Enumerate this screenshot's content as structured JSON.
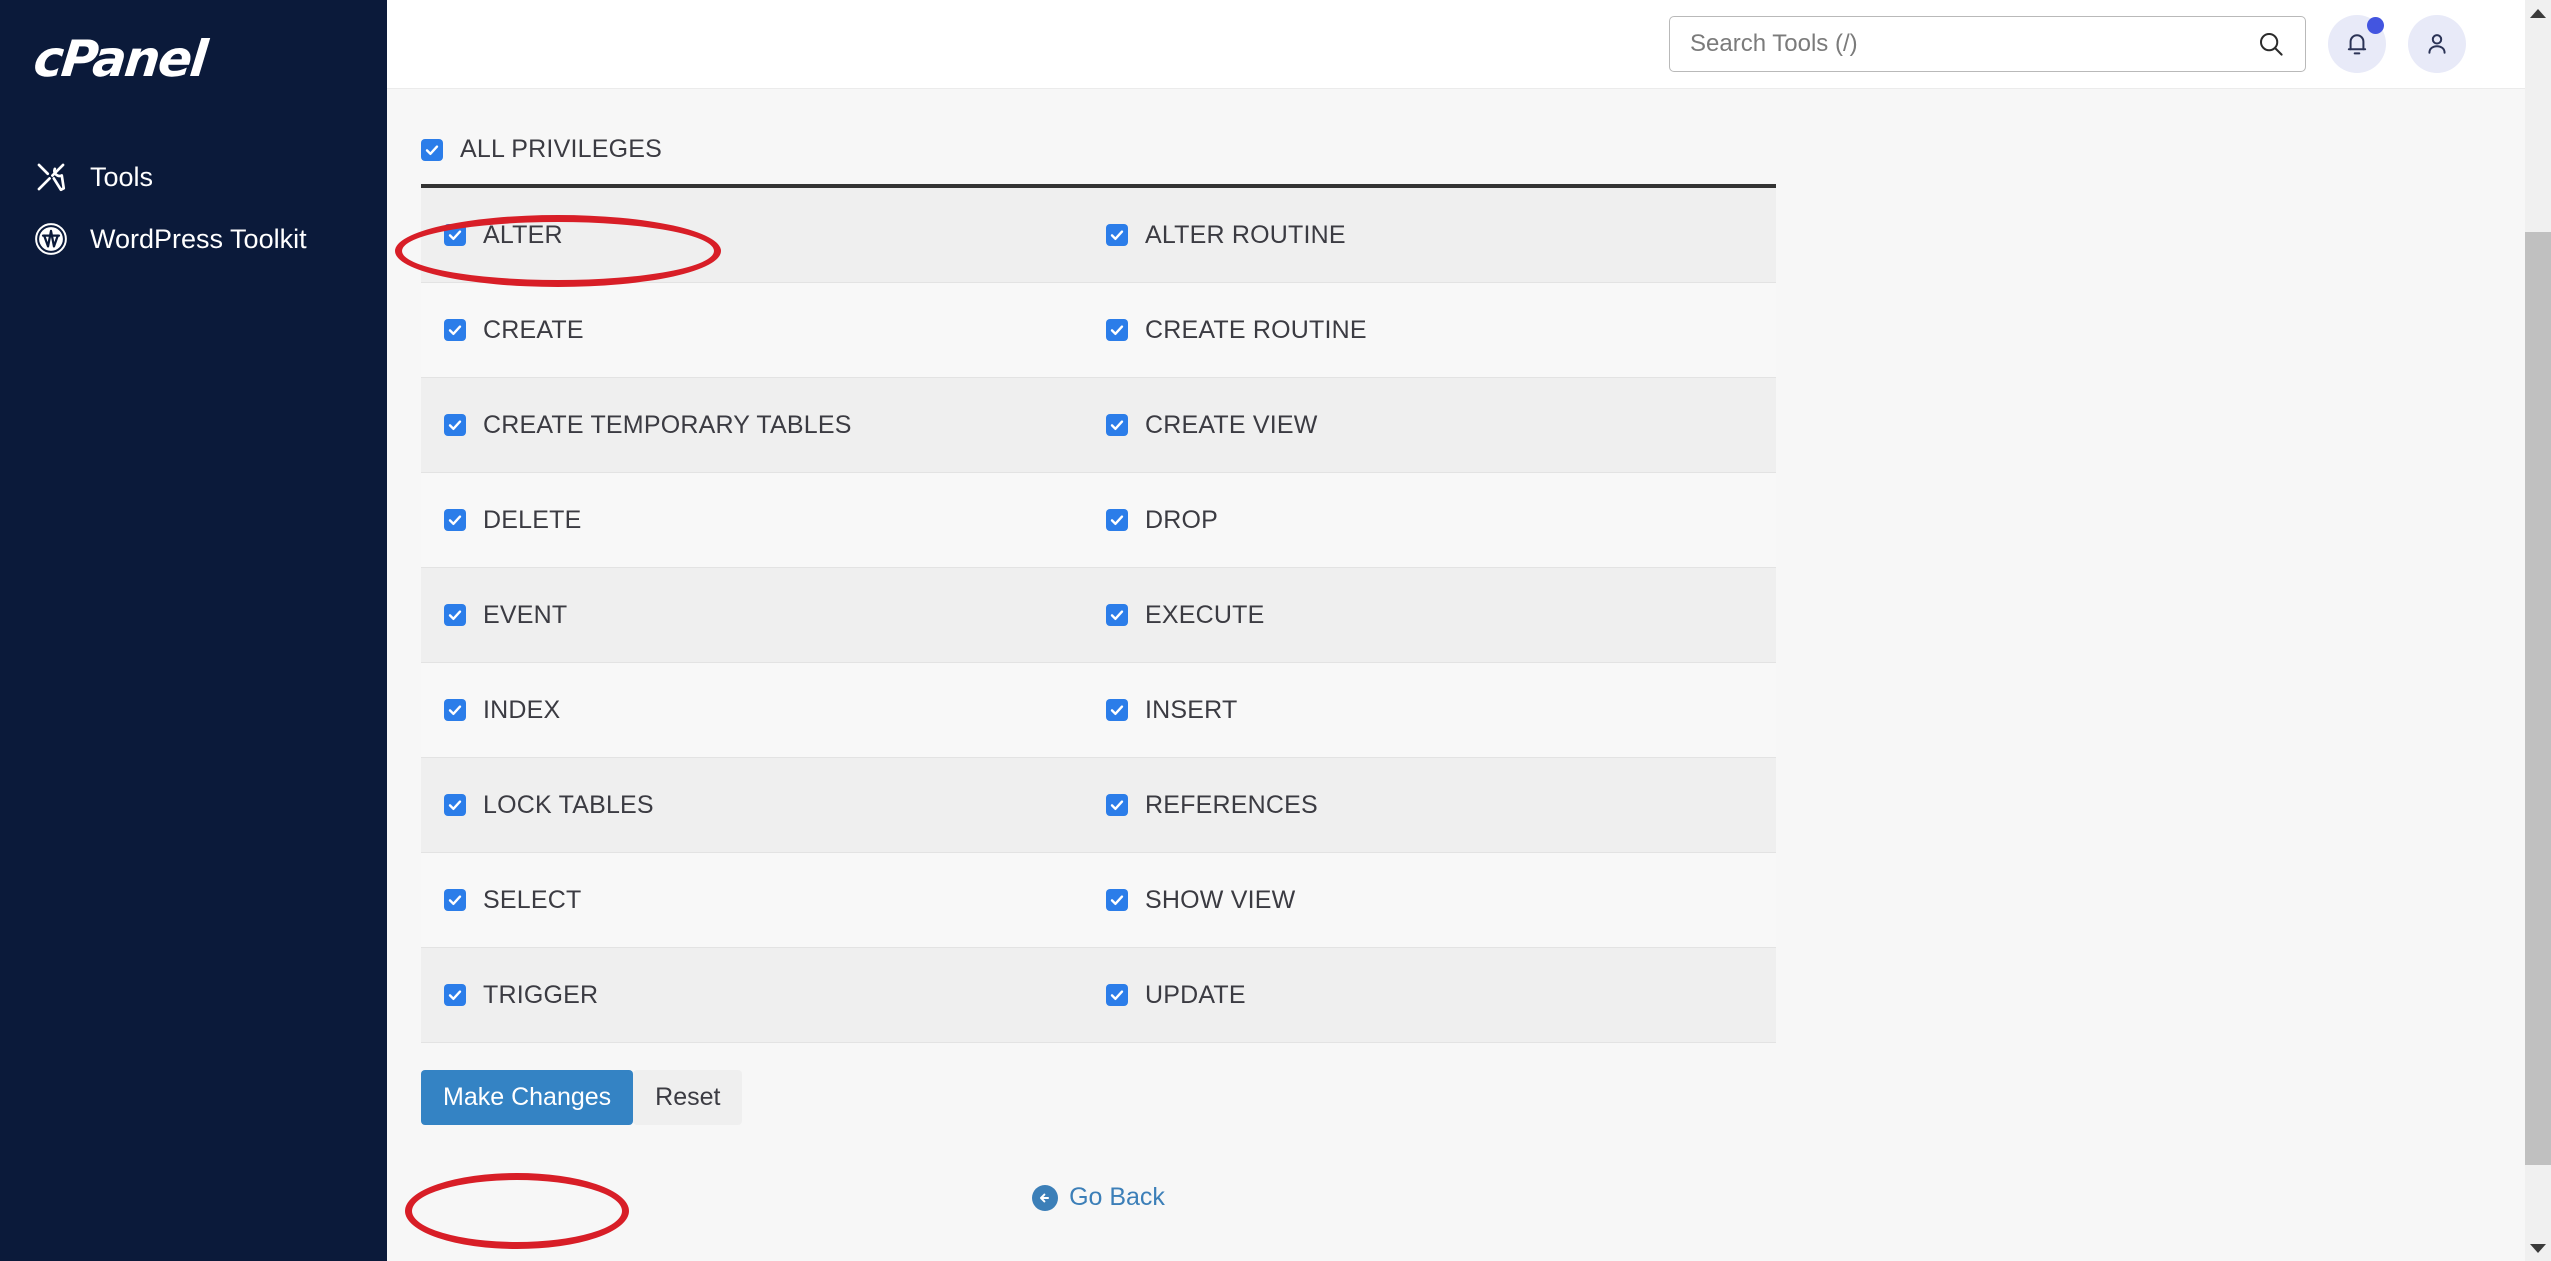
{
  "sidebar": {
    "brand": "cPanel",
    "items": [
      {
        "label": "Tools",
        "icon": "tools-icon"
      },
      {
        "label": "WordPress Toolkit",
        "icon": "wordpress-icon"
      }
    ]
  },
  "topbar": {
    "search": {
      "placeholder": "Search Tools (/)",
      "value": "",
      "icon": "search-icon"
    },
    "notifications": {
      "icon": "bell-icon",
      "has_badge": true
    },
    "account": {
      "icon": "user-icon"
    }
  },
  "main": {
    "all_privileges": {
      "label": "ALL PRIVILEGES",
      "checked": true
    },
    "privileges": [
      {
        "left": "ALTER",
        "right": "ALTER ROUTINE",
        "left_checked": true,
        "right_checked": true
      },
      {
        "left": "CREATE",
        "right": "CREATE ROUTINE",
        "left_checked": true,
        "right_checked": true
      },
      {
        "left": "CREATE TEMPORARY TABLES",
        "right": "CREATE VIEW",
        "left_checked": true,
        "right_checked": true
      },
      {
        "left": "DELETE",
        "right": "DROP",
        "left_checked": true,
        "right_checked": true
      },
      {
        "left": "EVENT",
        "right": "EXECUTE",
        "left_checked": true,
        "right_checked": true
      },
      {
        "left": "INDEX",
        "right": "INSERT",
        "left_checked": true,
        "right_checked": true
      },
      {
        "left": "LOCK TABLES",
        "right": "REFERENCES",
        "left_checked": true,
        "right_checked": true
      },
      {
        "left": "SELECT",
        "right": "SHOW VIEW",
        "left_checked": true,
        "right_checked": true
      },
      {
        "left": "TRIGGER",
        "right": "UPDATE",
        "left_checked": true,
        "right_checked": true
      }
    ],
    "buttons": {
      "submit": "Make Changes",
      "reset": "Reset"
    },
    "go_back": {
      "label": "Go Back",
      "icon": "arrow-left-circle-icon"
    }
  },
  "annotations": {
    "highlight_color": "#d81e27",
    "items": [
      {
        "target": "all-privileges-checkbox",
        "shape": "ellipse"
      },
      {
        "target": "make-changes-button",
        "shape": "ellipse"
      }
    ]
  },
  "colors": {
    "sidebar_bg": "#0b1a3a",
    "accent_blue": "#2b7de9",
    "primary_button": "#3483c4",
    "link_blue": "#3c7fb8",
    "annotation_red": "#d81e27",
    "badge_blue": "#4355e0",
    "row_odd": "#efefef",
    "row_even": "#f8f8f8"
  },
  "scrollbar": {
    "up_arrow": "triangle-up-icon",
    "down_arrow": "triangle-down-icon"
  }
}
